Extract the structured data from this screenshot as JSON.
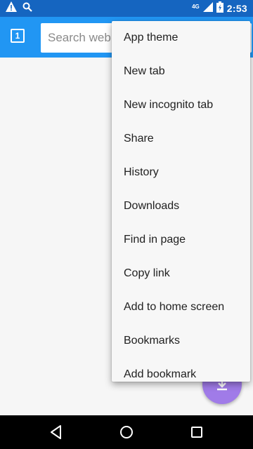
{
  "status_bar": {
    "time": "2:53",
    "network": "4G",
    "icons": [
      "warning-icon",
      "search-icon",
      "signal-icon",
      "battery-icon"
    ]
  },
  "toolbar": {
    "tab_count": "1",
    "search_placeholder": "Search web"
  },
  "menu": {
    "items": [
      "App theme",
      "New tab",
      "New incognito tab",
      "Share",
      "History",
      "Downloads",
      "Find in page",
      "Copy link",
      "Add to home screen",
      "Bookmarks",
      "Add bookmark"
    ]
  },
  "fab": {
    "icon": "download-icon",
    "color": "#a07be8"
  },
  "nav_bar": {
    "icons": [
      "back-icon",
      "home-icon",
      "recents-icon"
    ]
  },
  "colors": {
    "status_bar": "#1565c0",
    "toolbar": "#2196f3",
    "menu_background": "#f7f7f7",
    "content_background": "#f6f6f6"
  }
}
